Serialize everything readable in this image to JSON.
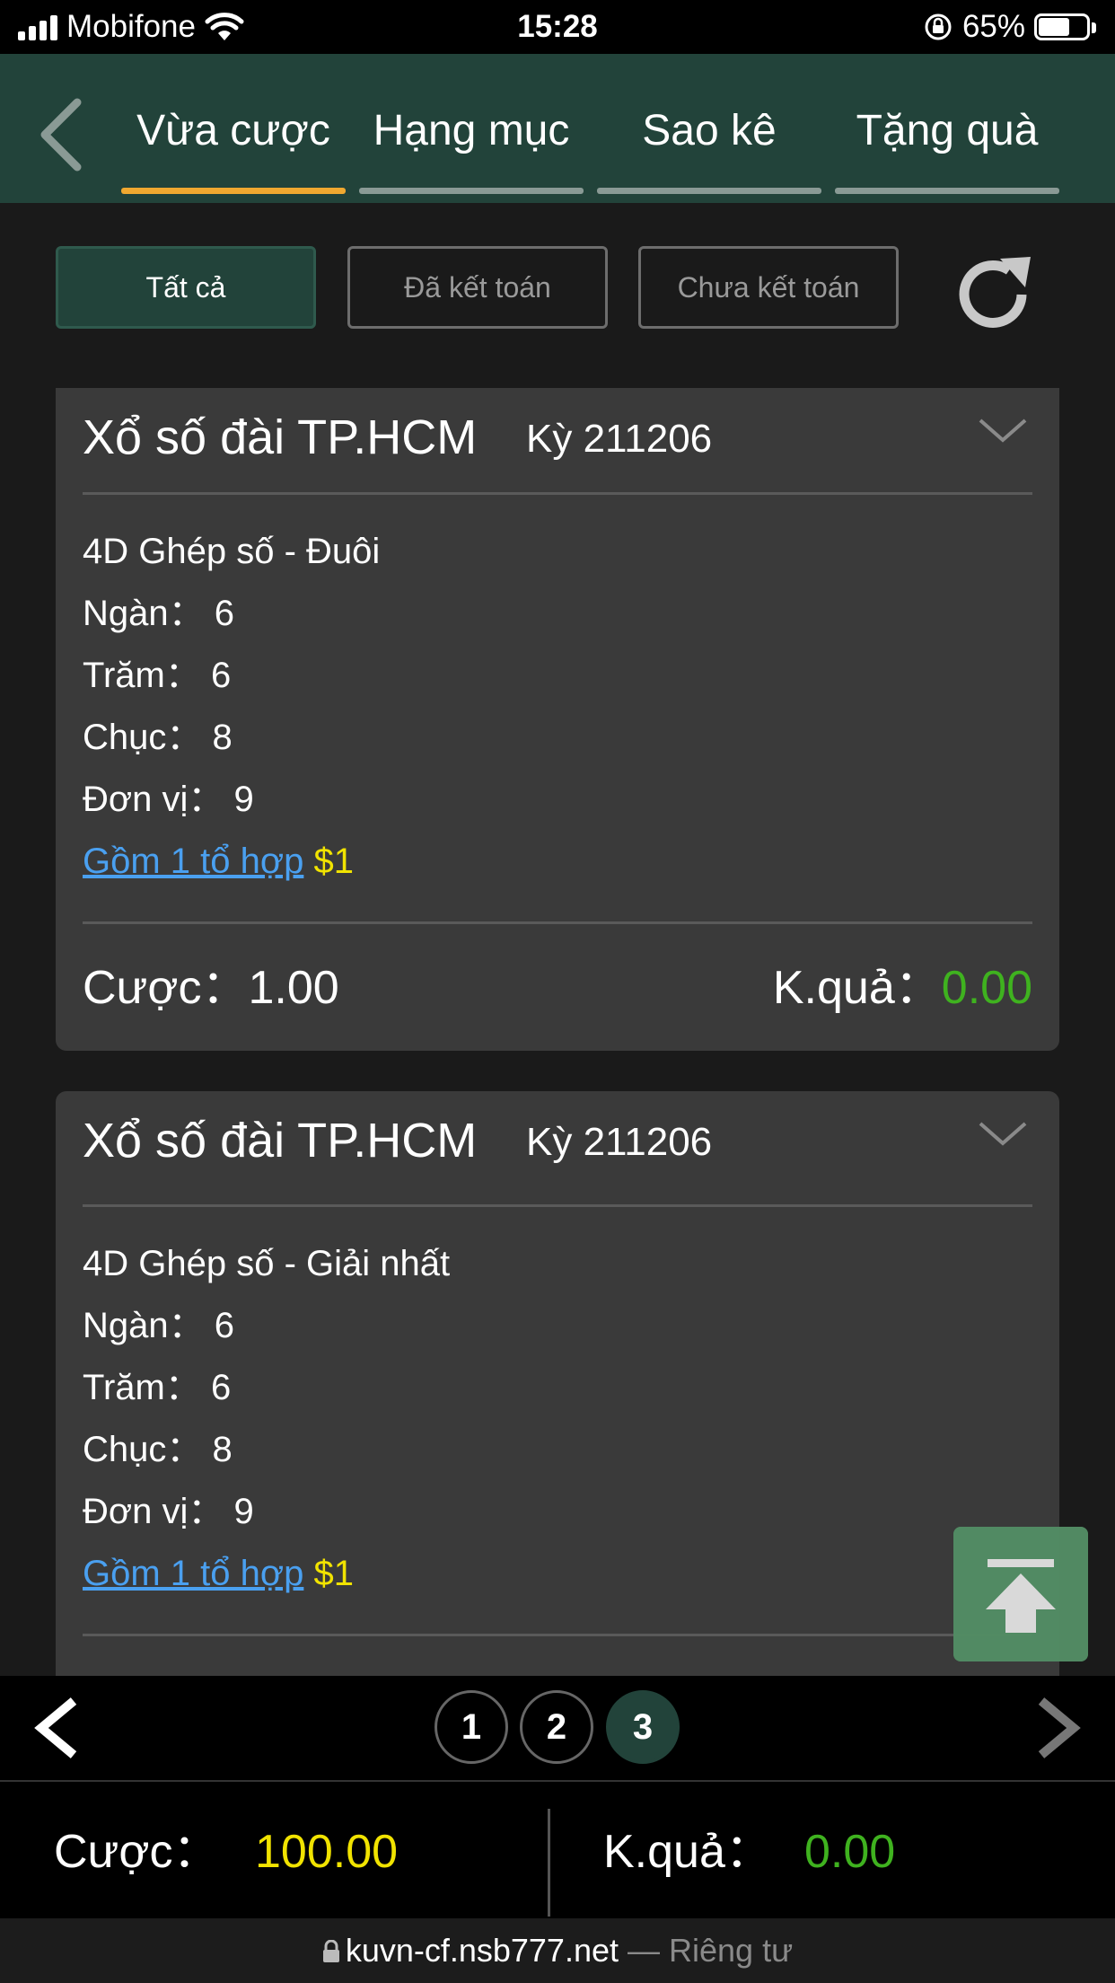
{
  "status_bar": {
    "carrier": "Mobifone",
    "time": "15:28",
    "battery_percent": "65%",
    "battery_level": 0.65
  },
  "nav": {
    "tabs": [
      {
        "label": "Vừa cược",
        "active": true
      },
      {
        "label": "Hạng mục",
        "active": false
      },
      {
        "label": "Sao kê",
        "active": false
      },
      {
        "label": "Tặng quà",
        "active": false
      }
    ]
  },
  "filters": {
    "all": "Tất cả",
    "settled": "Đã kết toán",
    "unsettled": "Chưa kết toán",
    "active": "all"
  },
  "cards": [
    {
      "title": "Xổ số đài TP.HCM",
      "period": "Kỳ 211206",
      "bet_type": "4D Ghép số - Đuôi",
      "digits": [
        {
          "label": "Ngàn：",
          "value": "6"
        },
        {
          "label": "Trăm：",
          "value": "6"
        },
        {
          "label": "Chục：",
          "value": "8"
        },
        {
          "label": "Đơn vị：",
          "value": "9"
        }
      ],
      "combo_text": "Gồm 1 tổ hợp",
      "combo_amount": "$1",
      "bet_label": "Cược：",
      "bet_value": "1.00",
      "result_label": "K.quả：",
      "result_value": "0.00"
    },
    {
      "title": "Xổ số đài TP.HCM",
      "period": "Kỳ 211206",
      "bet_type": "4D Ghép số - Giải nhất",
      "digits": [
        {
          "label": "Ngàn：",
          "value": "6"
        },
        {
          "label": "Trăm：",
          "value": "6"
        },
        {
          "label": "Chục：",
          "value": "8"
        },
        {
          "label": "Đơn vị：",
          "value": "9"
        }
      ],
      "combo_text": "Gồm 1 tổ hợp",
      "combo_amount": "$1"
    }
  ],
  "pagination": {
    "pages": [
      "1",
      "2",
      "3"
    ],
    "current": "3"
  },
  "totals": {
    "bet_label": "Cược：",
    "bet_value": "100.00",
    "result_label": "K.quả：",
    "result_value": "0.00"
  },
  "url_bar": {
    "host": "kuvn-cf.nsb777.net",
    "privacy": " — Riêng tư"
  },
  "colors": {
    "nav_bg": "#22433a",
    "tab_active": "#f0a830",
    "tab_inactive": "#8a9a95",
    "win_green": "#3fb21f",
    "amount_yellow": "#f1e300",
    "link_blue": "#4aa0f0"
  }
}
